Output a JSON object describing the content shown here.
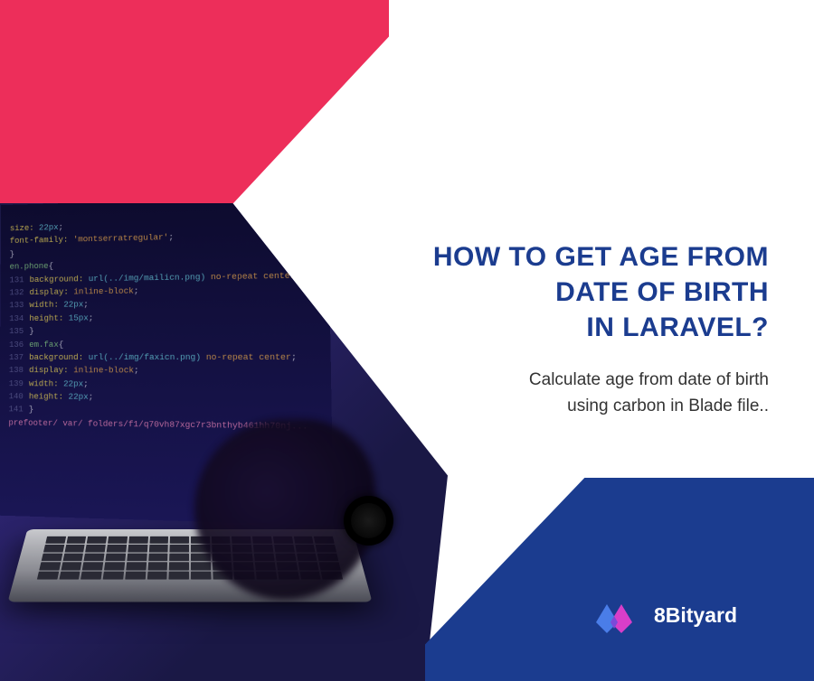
{
  "title": {
    "line1": "HOW TO GET AGE FROM",
    "line2": "DATE OF BIRTH",
    "line3": "IN LARAVEL?"
  },
  "subtitle": {
    "line1": "Calculate age from date of birth",
    "line2": "using carbon in Blade file.."
  },
  "brand": {
    "name": "8Bityard"
  },
  "colors": {
    "pink": "#ed2e5a",
    "blue": "#1b3c8f",
    "white": "#ffffff"
  },
  "code_snippets": [
    "size: 22px;",
    "font-family: 'montserratregular';",
    "}",
    "en.phone{",
    "background: url(../img/mailicn.png) no-repeat center;",
    "display: inline-block;",
    "width: 22px;",
    "height: 15px;",
    "}",
    "em.fax{",
    "background: url(../img/faxicn.png) no-repeat center;",
    "display: inline-block;",
    "width: 22px;",
    "height: 22px;",
    "}",
    "prefooter/ var/ folders/f1/q70vh87xgc7r3bnthyb461hh70nj..."
  ]
}
